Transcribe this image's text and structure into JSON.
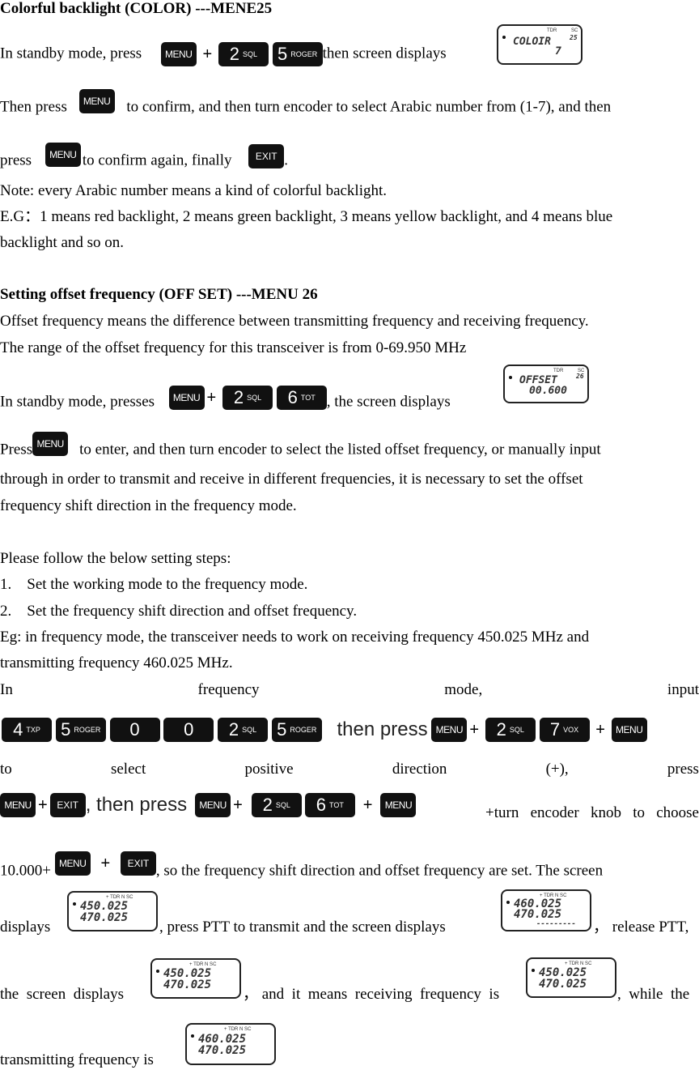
{
  "sections": {
    "color": {
      "heading": "Colorful backlight (COLOR) ---MENE25",
      "line1_a": "In standby mode, press",
      "line1_b": "then screen displays",
      "lcd": {
        "main": "COLOIR",
        "sub": "7",
        "menu_no": "25",
        "label_tdr": "TDR",
        "label_sc": "SC"
      },
      "line2": "Then press",
      "line2_b": "to confirm, and then turn encoder to select Arabic number from (1-7), and then",
      "line3_a": "press",
      "line3_b": "to confirm again, finally",
      "line3_c": ".",
      "note": "Note: every Arabic number means a kind of colorful backlight.",
      "eg1": "E.G：1 means red backlight, 2 means green backlight, 3 means yellow backlight, and 4 means blue",
      "eg2": "backlight and so on."
    },
    "offset": {
      "heading": "Setting offset frequency (OFF SET) ---MENU 26",
      "p1": "Offset frequency means the difference between transmitting frequency and receiving frequency.",
      "p2": "The range of the offset frequency for this transceiver is from 0-69.950 MHz",
      "line_a": "In standby mode, presses",
      "line_b": ", the screen displays",
      "lcd": {
        "main": "OFFSET",
        "sub": "00.600",
        "menu_no": "26",
        "label_tdr": "TDR",
        "label_sc": "SC"
      },
      "press": "Press",
      "press_b": "to enter, and then turn encoder to select the listed offset frequency, or manually input",
      "p3": "through in order to transmit and receive in different frequencies, it is necessary to set the offset",
      "p4": "frequency shift direction in the frequency mode.",
      "steps_intro": "Please follow the below setting steps:",
      "steps": [
        "1.    Set the working mode to the frequency mode.",
        "2.    Set the frequency shift direction and offset frequency."
      ],
      "eg1": "Eg: in frequency mode, the transceiver needs to work on receiving frequency 450.025 MHz and",
      "eg2": "transmitting frequency 460.025 MHz.",
      "in_line": [
        "In",
        "frequency",
        "mode,",
        "input"
      ],
      "then_press": "then press",
      "to_line": [
        "to",
        "select",
        "positive",
        "direction",
        "(+),",
        "press"
      ],
      "then_press2": ", then press",
      "turn_line": "+turn   encoder   knob   to   choose",
      "ten": "10.000+",
      "ten_b": ", so the frequency shift direction and offset frequency are set. The screen",
      "displays": "displays",
      "ptt": ", press PTT to transmit and the screen displays",
      "release": "， release PTT,",
      "the_screen": "the  screen  displays",
      "means": "， and  it  means  receiving  frequency  is",
      "while": ",  while  the",
      "tx_is": "transmitting frequency is"
    }
  },
  "keys": {
    "menu": "MENU",
    "exit": "EXIT",
    "k2": {
      "num": "2",
      "sub": "SQL"
    },
    "k4": {
      "num": "4",
      "sub": "TXP"
    },
    "k5": {
      "num": "5",
      "sub": "ROGER"
    },
    "k6": {
      "num": "6",
      "sub": "TOT"
    },
    "k7": {
      "num": "7",
      "sub": "VOX"
    },
    "k0": "0",
    "plus": "+"
  },
  "lcds": {
    "rx": {
      "l1": "450.025",
      "l2": "470.025",
      "icons": "+  TDR  N  SC"
    },
    "tx": {
      "l1": "460.025",
      "l2": "470.025",
      "bar": "---------",
      "icons": "+  TDR  N  SC"
    }
  }
}
